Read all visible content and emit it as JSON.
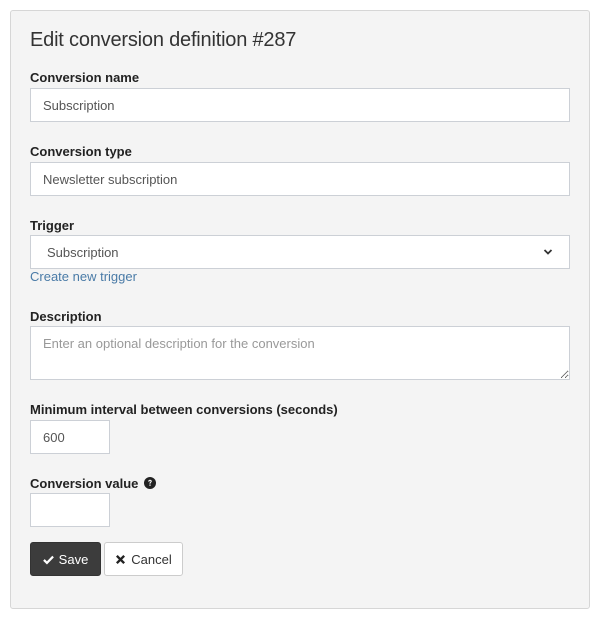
{
  "form": {
    "title": "Edit conversion definition #287",
    "fields": {
      "name": {
        "label": "Conversion name",
        "value": "Subscription"
      },
      "type": {
        "label": "Conversion type",
        "value": "Newsletter subscription"
      },
      "trigger": {
        "label": "Trigger",
        "selected": "Subscription",
        "create_link": "Create new trigger"
      },
      "description": {
        "label": "Description",
        "value": "",
        "placeholder": "Enter an optional description for the conversion"
      },
      "interval": {
        "label": "Minimum interval between conversions (seconds)",
        "value": "600"
      },
      "value": {
        "label": "Conversion value",
        "value": "",
        "help_icon": "question-circle-icon"
      }
    },
    "buttons": {
      "save": {
        "label": "Save",
        "icon": "check-icon"
      },
      "cancel": {
        "label": "Cancel",
        "icon": "times-icon"
      }
    }
  },
  "colors": {
    "panel_bg": "#f4f4f4",
    "link": "#4a7ba7",
    "save_bg": "#3c3c3c"
  }
}
